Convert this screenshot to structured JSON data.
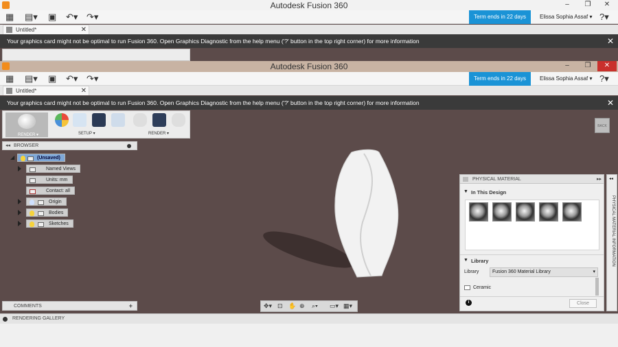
{
  "window": {
    "title": "Autodesk Fusion 360"
  },
  "window_controls": {
    "minimize": "–",
    "maximize": "❐",
    "close": "✕"
  },
  "quick_access": {
    "grid_icon": "grid-icon",
    "file_icon": "file-icon",
    "save_icon": "save-icon",
    "undo_icon": "undo-icon",
    "redo_icon": "redo-icon"
  },
  "account": {
    "term_notice": "Term ends in 22 days",
    "user_name": "Elissa Sophia Assaf",
    "help_label": "?"
  },
  "document_tab": {
    "name": "Untitled*",
    "close": "✕"
  },
  "notice": {
    "message": "Your graphics card might not be optimal to run Fusion 360. Open Graphics Diagnostic from the help menu ('?' button in the top right corner) for more information",
    "close": "✕"
  },
  "toolbar": {
    "workspace_label": "RENDER ▾",
    "setup_label": "SETUP ▾",
    "render_label": "RENDER ▾"
  },
  "view_cube": {
    "label": "BACK"
  },
  "browser": {
    "title": "BROWSER",
    "root": "(Unsaved)",
    "items": [
      {
        "label": "Named Views"
      },
      {
        "label": "Units: mm"
      },
      {
        "label": "Contact: all"
      },
      {
        "label": "Origin"
      },
      {
        "label": "Bodies"
      },
      {
        "label": "Sketches"
      }
    ]
  },
  "comments": {
    "title": "COMMENTS",
    "add": "+"
  },
  "rendering_gallery": {
    "title": "RENDERING GALLERY"
  },
  "physical_material": {
    "title": "PHYSICAL MATERIAL",
    "in_this_design": "In This Design",
    "library_section": "Library",
    "library_label": "Library",
    "library_value": "Fusion 360 Material Library",
    "folder_item": "Ceramic",
    "close_button": "Close",
    "info_icon": "i"
  },
  "side_tab": {
    "label": "PHYSICAL MATERIAL INFORMATION"
  },
  "colors": {
    "accent_blue": "#1a93d6",
    "canvas": "#5c4b4a",
    "close_red": "#c9302c"
  }
}
